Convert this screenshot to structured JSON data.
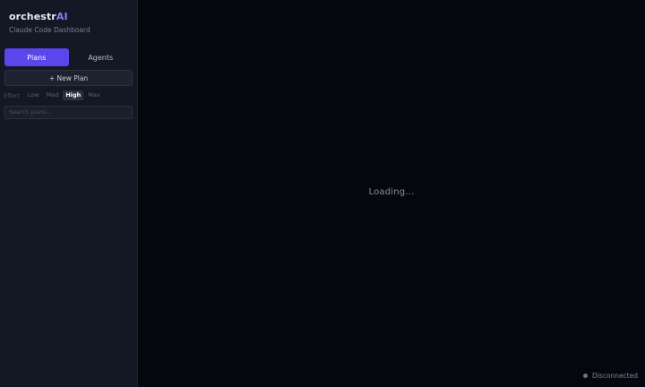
{
  "brand": {
    "name_prefix": "orchestr",
    "name_accent": "AI",
    "subtitle": "Claude Code Dashboard",
    "accent_color": "#8b7cf7"
  },
  "tabs": [
    {
      "label": "Plans",
      "active": true
    },
    {
      "label": "Agents",
      "active": false
    }
  ],
  "new_plan_label": "+ New Plan",
  "effort": {
    "label": "Effort",
    "options": [
      "Low",
      "Med",
      "High",
      "Max"
    ],
    "selected": "High"
  },
  "search": {
    "placeholder": "Search plans...",
    "value": ""
  },
  "main": {
    "loading_text": "Loading..."
  },
  "status": {
    "text": "Disconnected",
    "dot_color": "#6e7384"
  },
  "colors": {
    "primary": "#5b46ee",
    "sidebar_bg": "#141824",
    "main_bg": "#05070e"
  }
}
